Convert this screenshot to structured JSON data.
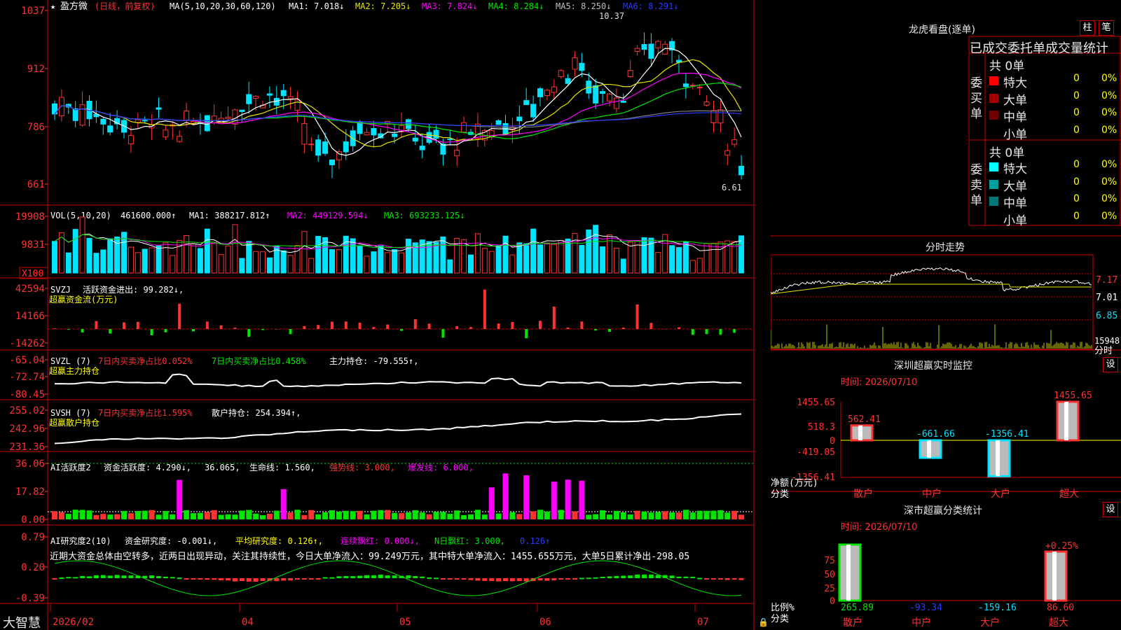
{
  "colors": {
    "up": "#ff3232",
    "down": "#00e4ff",
    "ma1": "#ffffff",
    "ma2": "#e6e600",
    "ma3": "#ff00ff",
    "ma4": "#00e600",
    "ma5": "#808080",
    "ma6": "#2a3bff",
    "axis": "#cc0000",
    "bg": "#000000"
  },
  "header": {
    "star": "★",
    "name": "盈方微",
    "mode": "(日线，前复权)",
    "ma_label": "MA(5,10,20,30,60,120)",
    "ma_items": [
      {
        "label": "MA1: 7.018↓",
        "color": "#ffffff"
      },
      {
        "label": "MA2: 7.205↓",
        "color": "#e6e600"
      },
      {
        "label": "MA3: 7.824↓",
        "color": "#ff00ff"
      },
      {
        "label": "MA4: 8.284↓",
        "color": "#00e600"
      },
      {
        "label": "MA5: 8.250↓",
        "color": "#c0c0c0"
      },
      {
        "label": "MA6: 8.291↓",
        "color": "#2a3bff"
      }
    ],
    "high_label": "10.37",
    "low_label": "6.61"
  },
  "panels": {
    "price": {
      "ticks": [
        "1037",
        "912",
        "786",
        "661"
      ]
    },
    "vol": {
      "title": "VOL(5,10,20)",
      "value": "461600.000↑",
      "ma1": "MA1: 388217.812↑",
      "ma2": "MA2: 449129.594↓",
      "ma3": "MA3: 693233.125↓",
      "ticks": [
        "19908",
        "9831"
      ],
      "unit": "X100"
    },
    "svzj": {
      "title": "SVZJ",
      "l1": "活跃资金进出: 99.282↓,",
      "l2": "超赢资金流(万元)",
      "ticks": [
        "42594",
        "14166",
        "-14262"
      ]
    },
    "svzl": {
      "title": "SVZL (7)",
      "a": "7日内买卖净占比0.052%",
      "b": "7日内买卖净占比0.458%",
      "c": "主力持仓: -79.555↑,",
      "l2": "超赢主力持仓",
      "ticks": [
        "-65.04",
        "-72.74",
        "-80.45"
      ]
    },
    "svsh": {
      "title": "SVSH (7)",
      "a": "7日内买卖净占比1.595%",
      "c": "散户持仓: 254.394↑,",
      "l2": "超赢散户持仓",
      "ticks": [
        "255.02",
        "242.96",
        "231.36"
      ]
    },
    "ai2": {
      "title": "AI活跃度2",
      "a": "资金活跃度: 4.290↓,",
      "b": "36.065,",
      "c": "生命线: 1.560,",
      "d": "强势线: 3.000,",
      "e": "爆发线: 6.000,",
      "ticks": [
        "36.06",
        "17.82",
        "0.00"
      ]
    },
    "ai10": {
      "title": "AI研究度2(10)",
      "a": "资金研究度: -0.001↓,",
      "b": "平均研究度: 0.126↑,",
      "c": "连续飘红: 0.000↓,",
      "d": "N日飘红: 3.000,",
      "e": "0.126↑",
      "summary": "近期大资金总体由空转多，近两日出现异动，关注其持续性，今日大单净流入：99.249万元，其中特大单净流入：1455.655万元，大单5日累计净出-298.05",
      "ticks": [
        "0.79",
        "0.20",
        "-0.39"
      ]
    }
  },
  "xaxis": {
    "brand": "大智慧",
    "labels": [
      "2026/02",
      "04",
      "05",
      "06",
      "07"
    ]
  },
  "right": {
    "dragon": {
      "title": "龙虎看盘(逐单)",
      "btn1": "柱",
      "btn2": "笔",
      "stat_title": "已成交委托单成交量统计",
      "buy": {
        "side": "委买单",
        "total": "共 0单",
        "rows": [
          {
            "label": "特大",
            "v": "0",
            "p": "0%",
            "c": "#ff0000"
          },
          {
            "label": "大单",
            "v": "0",
            "p": "0%",
            "c": "#a00000"
          },
          {
            "label": "中单",
            "v": "0",
            "p": "0%",
            "c": "#700000"
          },
          {
            "label": "小单",
            "v": "0",
            "p": "0%",
            "c": "#000000"
          }
        ]
      },
      "sell": {
        "side": "委卖单",
        "total": "共 0单",
        "rows": [
          {
            "label": "特大",
            "v": "0",
            "p": "0%",
            "c": "#00ffff"
          },
          {
            "label": "大单",
            "v": "0",
            "p": "0%",
            "c": "#00a0a0"
          },
          {
            "label": "中单",
            "v": "0",
            "p": "0%",
            "c": "#007878"
          },
          {
            "label": "小单",
            "v": "0",
            "p": "0%",
            "c": "#000000"
          }
        ]
      }
    },
    "intraday": {
      "title": "分时走势",
      "ticks": [
        "7.17",
        "7.01",
        "6.85"
      ],
      "vol": "15948",
      "vol_unit": "分时"
    },
    "monitor": {
      "title": "深圳超赢实时监控",
      "btn": "设",
      "time": "时间: 2026/07/10",
      "ticks": [
        "1455.65",
        "518.3",
        "0",
        "-419.05",
        "-1356.41"
      ],
      "ylabel": "净额(万元)",
      "xlabel": "分类",
      "cats": [
        "散户",
        "中户",
        "大户",
        "超大"
      ],
      "values": [
        562.41,
        -661.66,
        -1356.41,
        1455.65
      ],
      "labels": [
        "562.41",
        "-661.66",
        "-1356.41",
        "1455.65"
      ]
    },
    "classify": {
      "title": "深市超赢分类统计",
      "btn": "设",
      "time": "时间: 2026/07/10",
      "ticks": [
        "75",
        "50",
        "25",
        "0"
      ],
      "ylabel": "比例%",
      "xlabel": "分类",
      "top_label": "+0.25%",
      "cats": [
        "散户",
        "中户",
        "大户",
        "超大"
      ],
      "labels": [
        "265.89",
        "-93.34",
        "-159.16",
        "86.60"
      ]
    }
  },
  "chart_data": [
    {
      "type": "candlestick",
      "title": "盈方微 (日线，前复权)",
      "ylim": [
        6.61,
        10.37
      ],
      "high": 10.37,
      "low": 6.61,
      "ma": {
        "MA1": 7.018,
        "MA2": 7.205,
        "MA3": 7.824,
        "MA4": 8.284,
        "MA5": 8.25,
        "MA6": 8.291
      }
    },
    {
      "type": "bar",
      "title": "VOL(5,10,20)",
      "value": 461600.0,
      "ma": {
        "MA1": 388217.812,
        "MA2": 449129.594,
        "MA3": 693233.125
      }
    },
    {
      "type": "bar",
      "title": "SVZJ 超赢资金流(万元)",
      "value": 99.282
    },
    {
      "type": "line",
      "title": "SVZL 超赢主力持仓",
      "value": -79.555
    },
    {
      "type": "line",
      "title": "SVSH 超赢散户持仓",
      "value": 254.394
    },
    {
      "type": "bar",
      "title": "AI活跃度2",
      "series": [
        {
          "name": "资金活跃度",
          "values": [
            4.29
          ]
        },
        {
          "name": "生命线",
          "values": [
            1.56
          ]
        },
        {
          "name": "强势线",
          "values": [
            3.0
          ]
        },
        {
          "name": "爆发线",
          "values": [
            6.0
          ]
        }
      ]
    },
    {
      "type": "bar",
      "title": "AI研究度2(10)",
      "series": [
        {
          "name": "资金研究度",
          "values": [
            -0.001
          ]
        },
        {
          "name": "平均研究度",
          "values": [
            0.126
          ]
        },
        {
          "name": "连续飘红",
          "values": [
            0.0
          ]
        },
        {
          "name": "N日飘红",
          "values": [
            3.0
          ]
        }
      ]
    },
    {
      "type": "bar",
      "title": "深圳超赢实时监控",
      "categories": [
        "散户",
        "中户",
        "大户",
        "超大"
      ],
      "values": [
        562.41,
        -661.66,
        -1356.41,
        1455.65
      ],
      "ylabel": "净额(万元)",
      "xlabel": "分类"
    },
    {
      "type": "bar",
      "title": "深市超赢分类统计",
      "categories": [
        "散户",
        "中户",
        "大户",
        "超大"
      ],
      "values": [
        265.89,
        -93.34,
        -159.16,
        86.6
      ],
      "ylabel": "比例%",
      "xlabel": "分类"
    }
  ]
}
